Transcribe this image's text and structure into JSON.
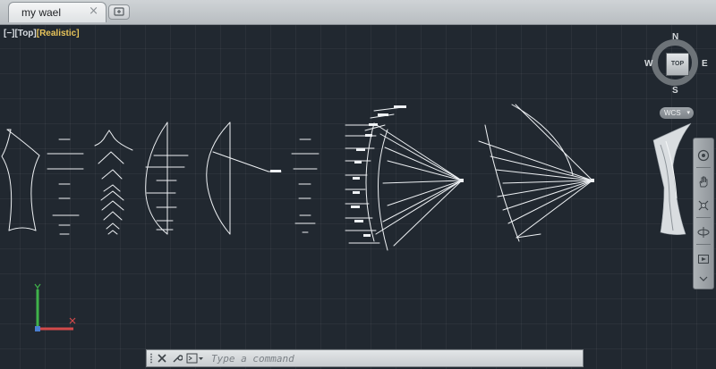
{
  "document_tab": {
    "title": "my wael",
    "close_symbol": "×"
  },
  "viewport": {
    "minus": "[−]",
    "view": "[Top]",
    "style": "[Realistic]"
  },
  "viewcube": {
    "north": "N",
    "south": "S",
    "east": "E",
    "west": "W",
    "face": "TOP"
  },
  "wcs": {
    "label": "WCS"
  },
  "command_line": {
    "placeholder": "Type a command"
  },
  "colors": {
    "canvas_bg": "#212830",
    "geometry": "#eef1f4",
    "ucs_x_axis": "#d24a4a",
    "ucs_y_axis": "#3fb24a",
    "ucs_z_axis": "#4a7fd2",
    "style_accent": "#e8c45a"
  },
  "icons": {
    "close": "close-icon",
    "customize": "wrench-icon",
    "command_prompt": "command-prompt-icon",
    "steering_wheel": "steering-wheel-icon",
    "pan": "pan-hand-icon",
    "zoom_extents": "zoom-extents-icon",
    "orbit": "orbit-icon",
    "showmotion": "showmotion-icon"
  }
}
